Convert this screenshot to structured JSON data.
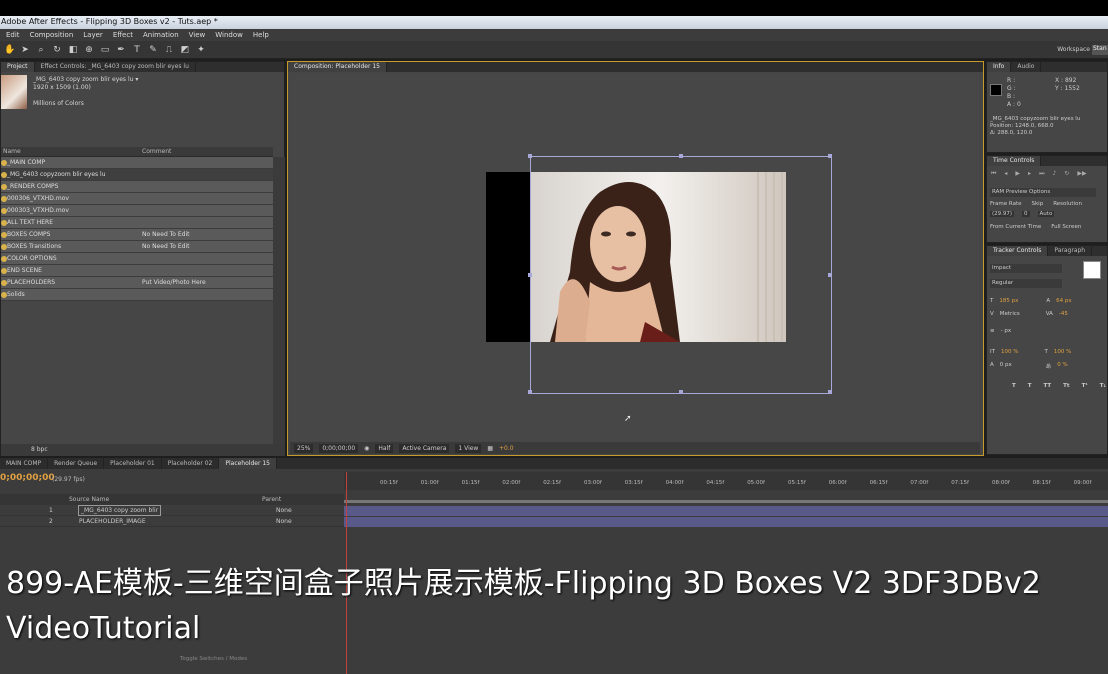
{
  "window": {
    "title": "Adobe After Effects - Flipping 3D Boxes v2 - Tuts.aep *"
  },
  "menu": [
    "Edit",
    "Composition",
    "Layer",
    "Effect",
    "Animation",
    "View",
    "Window",
    "Help"
  ],
  "workspace": {
    "label": "Workspace",
    "value": "Stan"
  },
  "project": {
    "tabs": [
      "Project",
      "Effect Controls: _MG_6403 copy zoom blir eyes lu"
    ],
    "selected_name": "_MG_6403 copy zoom blir eyes lu ▾",
    "selected_size": "1920 x 1509 (1.00)",
    "selected_colors": "Millions of Colors",
    "col_name": "Name",
    "col_comment": "Comment",
    "rows": [
      {
        "name": "_MAIN COMP",
        "comment": ""
      },
      {
        "name": "_MG_6403 copyzoom blir eyes lu",
        "comment": ""
      },
      {
        "name": "_RENDER COMPS",
        "comment": ""
      },
      {
        "name": "000306_VTXHD.mov",
        "comment": ""
      },
      {
        "name": "000303_VTXHD.mov",
        "comment": ""
      },
      {
        "name": "ALL TEXT HERE",
        "comment": ""
      },
      {
        "name": "BOXES COMPS",
        "comment": "No Need To Edit"
      },
      {
        "name": "BOXES Transitions",
        "comment": "No Need To Edit"
      },
      {
        "name": "COLOR OPTIONS",
        "comment": ""
      },
      {
        "name": "END SCENE",
        "comment": ""
      },
      {
        "name": "PLACEHOLDERS",
        "comment": "Put Video/Photo Here"
      },
      {
        "name": "Solids",
        "comment": ""
      }
    ],
    "bpc": "8 bpc"
  },
  "composition": {
    "tab": "Composition: Placeholder 15",
    "zoom": "25%",
    "timecode": "0;00;00;00",
    "resolution": "Half",
    "camera": "Active Camera",
    "view": "1 View",
    "exposure": "+0.0"
  },
  "info": {
    "tabs": [
      "Info",
      "Audio"
    ],
    "r": "R :",
    "g": "G :",
    "b": "B :",
    "a": "A : 0",
    "x": "X : 892",
    "y": "Y : 1552",
    "layer": "_MG_6403 copyzoom blir eyes lu",
    "position": "Position: 1248.0, 668.0",
    "delta": "Δ: 288.0, 120.0"
  },
  "time_controls": {
    "tab": "Time Controls",
    "preview": "RAM Preview Options",
    "frame_rate_label": "Frame Rate",
    "skip_label": "Skip",
    "resolution_label": "Resolution",
    "frame_rate": "(29.97)",
    "skip": "0",
    "resolution": "Auto",
    "from_current": "From Current Time",
    "full_screen": "Full Screen"
  },
  "character": {
    "tabs": [
      "Tracker Controls",
      "Paragraph"
    ],
    "font": "Impact",
    "style": "Regular",
    "size": "185 px",
    "leading": "64 px",
    "kerning": "Metrics",
    "tracking": "-45",
    "stroke": "- px",
    "vscale": "100 %",
    "hscale": "100 %",
    "baseline": "0 px",
    "tsume": "0 %"
  },
  "timeline": {
    "tabs": [
      "MAIN COMP",
      "Render Queue",
      "Placeholder 01",
      "Placeholder 02",
      "Placeholder 15"
    ],
    "time": "0;00;00;00",
    "fps": "(29.97 fps)",
    "ticks": [
      "00:15f",
      "01:00f",
      "01:15f",
      "02:00f",
      "02:15f",
      "03:00f",
      "03:15f",
      "04:00f",
      "04:15f",
      "05:00f",
      "05:15f",
      "06:00f",
      "06:15f",
      "07:00f",
      "07:15f",
      "08:00f",
      "08:15f",
      "09:00f"
    ],
    "col_source": "Source Name",
    "col_parent": "Parent",
    "layers": [
      {
        "num": "1",
        "name": "_MG_6403 copy zoom blir",
        "parent": "None"
      },
      {
        "num": "2",
        "name": "PLACEHOLDER_IMAGE",
        "parent": "None"
      }
    ],
    "toggle": "Toggle Switches / Modes"
  },
  "caption": {
    "line1": "899-AE模板-三维空间盒子照片展示模板-Flipping 3D Boxes V2 3DF3DBv2",
    "line2": "VideoTutorial"
  }
}
